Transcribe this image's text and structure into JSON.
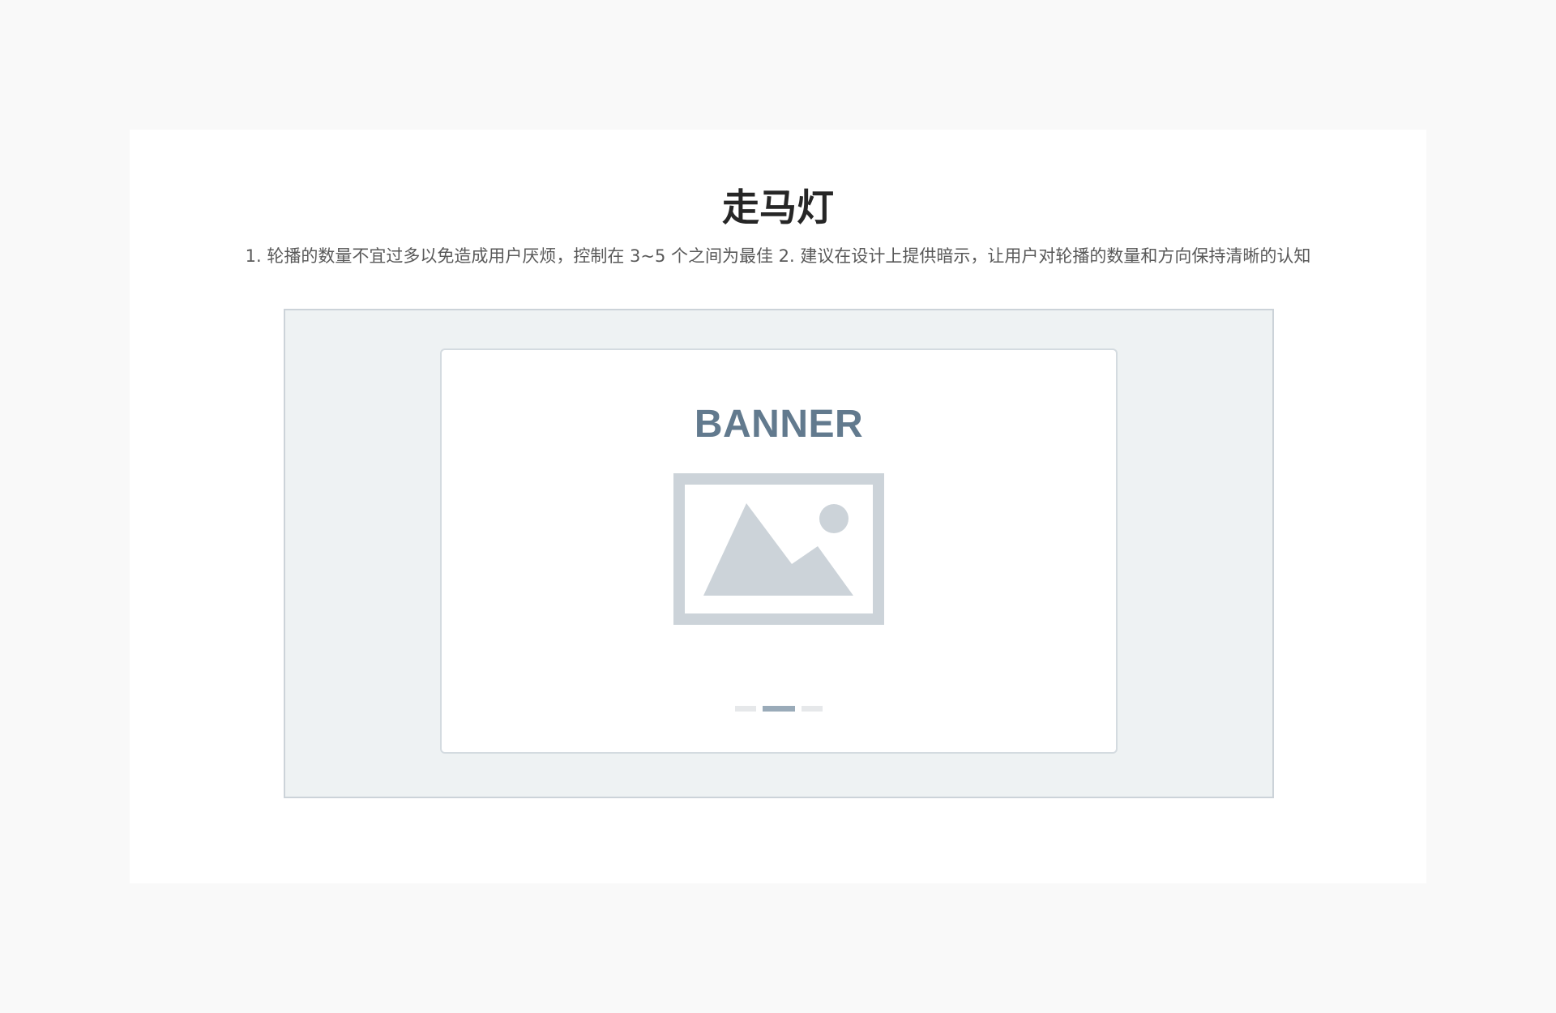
{
  "page": {
    "title": "走马灯",
    "description": "1. 轮播的数量不宜过多以免造成用户厌烦，控制在 3~5 个之间为最佳 2. 建议在设计上提供暗示，让用户对轮播的数量和方向保持清晰的认知"
  },
  "carousel": {
    "banner_label": "BANNER",
    "image_icon": "image-placeholder-icon",
    "indicator_count": 3,
    "active_index": 1
  },
  "colors": {
    "background": "#f9f9f9",
    "stage": "#eef2f3",
    "banner_text": "#627a8e",
    "icon": "#ccd3d9",
    "indicator": "#e6e8ea",
    "indicator_active": "#9aabb9"
  }
}
